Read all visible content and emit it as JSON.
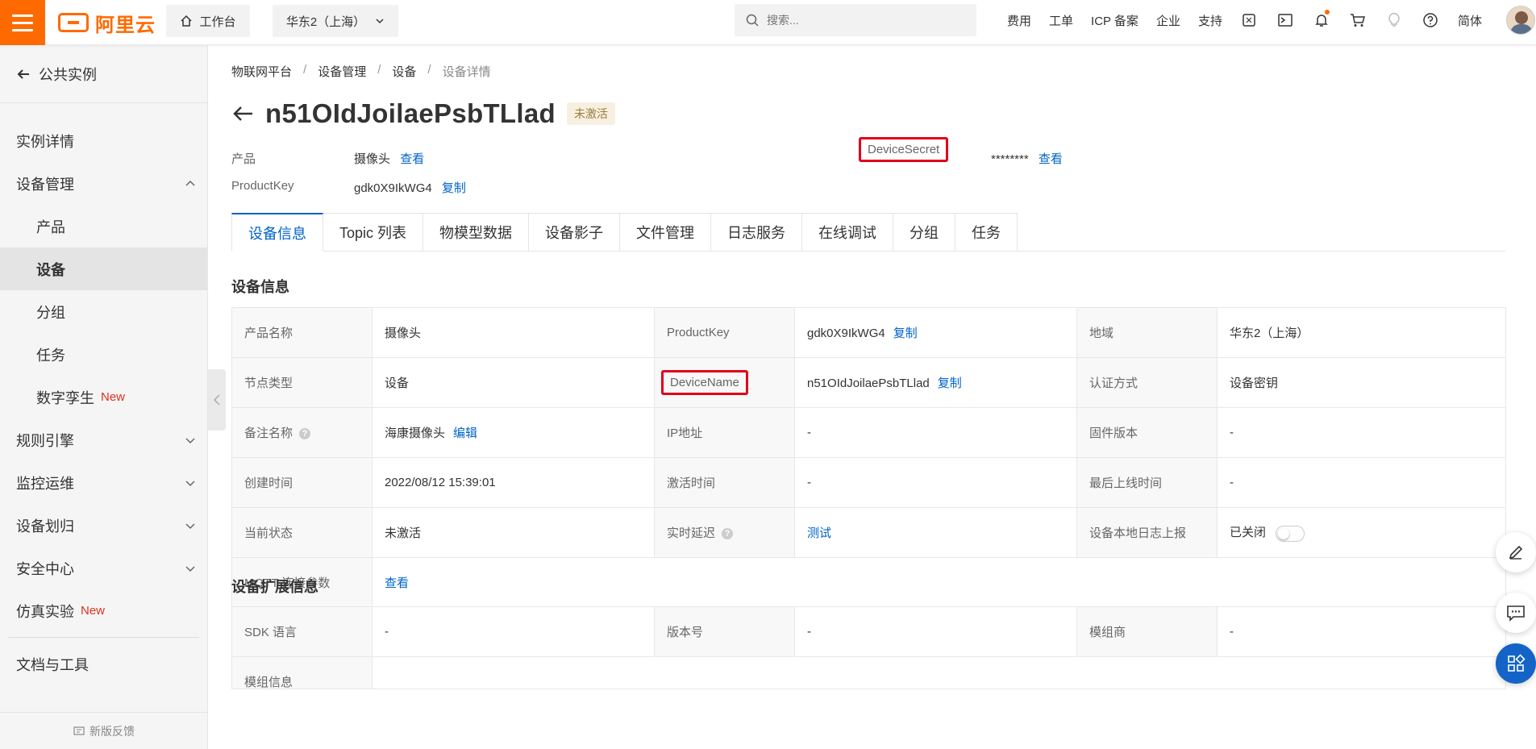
{
  "topbar": {
    "logo_text": "阿里云",
    "workbench_label": "工作台",
    "region_label": "华东2（上海）",
    "search_placeholder": "搜索...",
    "links": [
      "费用",
      "工单",
      "ICP 备案",
      "企业",
      "支持"
    ],
    "lang_label": "简体"
  },
  "sidebar": {
    "back_label": "公共实例",
    "items": [
      {
        "label": "实例详情"
      },
      {
        "label": "设备管理"
      },
      {
        "label": "产品"
      },
      {
        "label": "设备"
      },
      {
        "label": "分组"
      },
      {
        "label": "任务"
      },
      {
        "label": "数字孪生",
        "badge": "New"
      },
      {
        "label": "规则引擎"
      },
      {
        "label": "监控运维"
      },
      {
        "label": "设备划归"
      },
      {
        "label": "安全中心"
      },
      {
        "label": "仿真实验",
        "badge": "New"
      },
      {
        "label": "文档与工具"
      }
    ],
    "feedback_label": "新版反馈"
  },
  "breadcrumb": [
    "物联网平台",
    "设备管理",
    "设备",
    "设备详情"
  ],
  "title": "n51OIdJoilaePsbTLlad",
  "status_tag": "未激活",
  "meta": {
    "product_label": "产品",
    "product_value": "摄像头",
    "product_link": "查看",
    "productkey_label": "ProductKey",
    "productkey_value": "gdk0X9IkWG4",
    "productkey_link": "复制",
    "secret_label": "DeviceSecret",
    "secret_value": "********",
    "secret_link": "查看"
  },
  "tabs": [
    "设备信息",
    "Topic 列表",
    "物模型数据",
    "设备影子",
    "文件管理",
    "日志服务",
    "在线调试",
    "分组",
    "任务"
  ],
  "device_info": {
    "section_title": "设备信息",
    "rows": [
      [
        {
          "k": "产品名称",
          "v": "摄像头"
        },
        {
          "k": "ProductKey",
          "v": "gdk0X9IkWG4",
          "link": "复制"
        },
        {
          "k": "地域",
          "v": "华东2（上海）"
        }
      ],
      [
        {
          "k": "节点类型",
          "v": "设备"
        },
        {
          "k": "DeviceName",
          "v": "n51OIdJoilaePsbTLlad",
          "link": "复制"
        },
        {
          "k": "认证方式",
          "v": "设备密钥"
        }
      ],
      [
        {
          "k": "备注名称",
          "v": "海康摄像头",
          "link": "编辑"
        },
        {
          "k": "IP地址",
          "v": "-"
        },
        {
          "k": "固件版本",
          "v": "-"
        }
      ],
      [
        {
          "k": "创建时间",
          "v": "2022/08/12 15:39:01"
        },
        {
          "k": "激活时间",
          "v": "-"
        },
        {
          "k": "最后上线时间",
          "v": "-"
        }
      ],
      [
        {
          "k": "当前状态",
          "v": "未激活"
        },
        {
          "k": "实时延迟",
          "v": "测试"
        },
        {
          "k": "设备本地日志上报",
          "v": "已关闭"
        }
      ]
    ],
    "mqtt_label": "MQTT 连接参数",
    "mqtt_link": "查看"
  },
  "ext_info": {
    "section_title": "设备扩展信息",
    "rows": [
      [
        {
          "k": "SDK 语言",
          "v": "-"
        },
        {
          "k": "版本号",
          "v": "-"
        },
        {
          "k": "模组商",
          "v": "-"
        }
      ]
    ],
    "partial_label": "模组信息"
  }
}
